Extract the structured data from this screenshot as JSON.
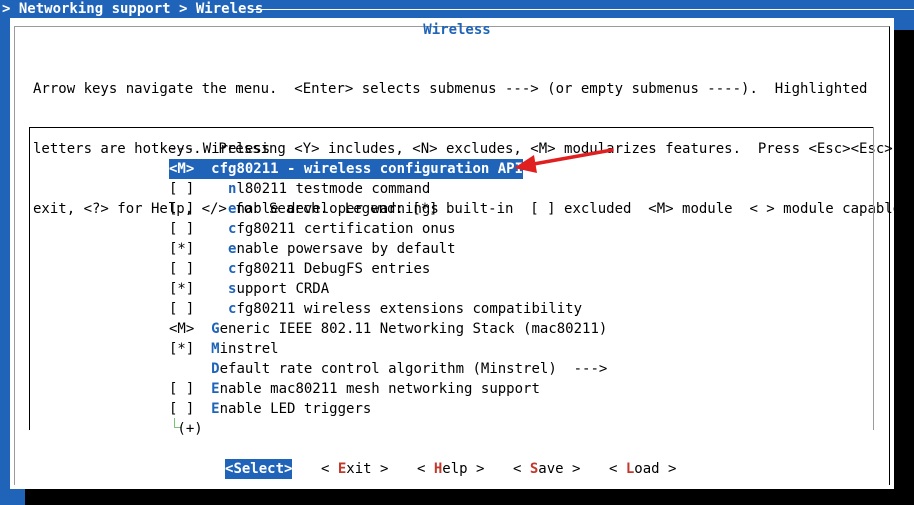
{
  "breadcrumb": "> Networking support > Wireless",
  "title": "Wireless",
  "help_lines": [
    "Arrow keys navigate the menu.  <Enter> selects submenus ---> (or empty submenus ----).  Highlighted",
    "letters are hotkeys.  Pressing <Y> includes, <N> excludes, <M> modularizes features.  Press <Esc><Esc> to",
    "exit, <?> for Help, </> for Search.  Legend: [*] built-in  [ ] excluded  <M> module  < > module capable"
  ],
  "menu": {
    "items": [
      {
        "pre": "--- Wireless",
        "hk": "",
        "post": ""
      },
      {
        "pre": "<M>  ",
        "hk": "c",
        "post": "fg80211 - wireless configuration API"
      },
      {
        "pre": "[ ]    ",
        "hk": "n",
        "post": "l80211 testmode command"
      },
      {
        "pre": "[ ]    ",
        "hk": "e",
        "post": "nable developer warnings"
      },
      {
        "pre": "[ ]    ",
        "hk": "c",
        "post": "fg80211 certification onus"
      },
      {
        "pre": "[*]    ",
        "hk": "e",
        "post": "nable powersave by default"
      },
      {
        "pre": "[ ]    ",
        "hk": "c",
        "post": "fg80211 DebugFS entries"
      },
      {
        "pre": "[*]    ",
        "hk": "s",
        "post": "upport CRDA"
      },
      {
        "pre": "[ ]    ",
        "hk": "c",
        "post": "fg80211 wireless extensions compatibility"
      },
      {
        "pre": "<M>  ",
        "hk": "G",
        "post": "eneric IEEE 802.11 Networking Stack (mac80211)"
      },
      {
        "pre": "[*]  ",
        "hk": "M",
        "post": "instrel"
      },
      {
        "pre": "     ",
        "hk": "D",
        "post": "efault rate control algorithm (Minstrel)  --->"
      },
      {
        "pre": "[ ]  ",
        "hk": "E",
        "post": "nable mac80211 mesh networking support"
      },
      {
        "pre": "[ ]  ",
        "hk": "E",
        "post": "nable LED triggers"
      }
    ],
    "more": " (+)"
  },
  "buttons": [
    {
      "pre": "<",
      "hk": "S",
      "post": "elect>"
    },
    {
      "pre": "< ",
      "hk": "E",
      "post": "xit >"
    },
    {
      "pre": "< ",
      "hk": "H",
      "post": "elp >"
    },
    {
      "pre": "< ",
      "hk": "S",
      "post": "ave >"
    },
    {
      "pre": "< ",
      "hk": "L",
      "post": "oad >"
    }
  ],
  "colors": {
    "accent": "#1f64b8",
    "arrow": "#e02020",
    "hotkey_button": "#c0392b"
  }
}
